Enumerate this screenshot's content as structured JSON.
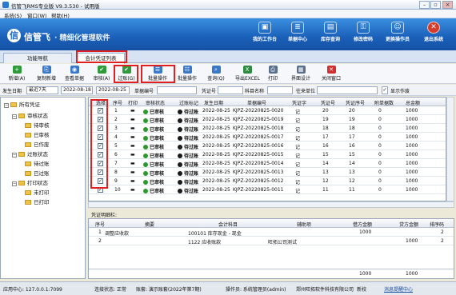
{
  "window": {
    "title": "信管飞RMS专业版 V9.3.530 - 试用版"
  },
  "menu": [
    "系统(S)",
    "窗口(W)",
    "帮助(H)"
  ],
  "brand": {
    "name": "信管飞",
    "tagline": "· 精细化管理软件",
    "icon": "信"
  },
  "banner_buttons": [
    {
      "label": "我的工作台",
      "icon": "desk-icon",
      "glyph": "▣"
    },
    {
      "label": "单据中心",
      "icon": "document-center-icon",
      "glyph": "≣"
    },
    {
      "label": "库存查询",
      "icon": "inventory-icon",
      "glyph": "▤"
    },
    {
      "label": "修改密码",
      "icon": "key-icon",
      "glyph": "⚿"
    },
    {
      "label": "更换操作员",
      "icon": "users-icon",
      "glyph": "☺"
    },
    {
      "label": "退出系统",
      "icon": "exit-icon",
      "glyph": "✕"
    }
  ],
  "tabs": [
    {
      "label": "功能导航"
    },
    {
      "label": "会计凭证列表"
    }
  ],
  "toolbar": [
    {
      "label": "新增(A)",
      "icon": "add-icon",
      "glyph": "+",
      "color": "#2f9a3a"
    },
    {
      "label": "复制新增",
      "icon": "copy-icon",
      "glyph": "⎘",
      "color": "#3a78c8"
    },
    {
      "label": "查看单据",
      "icon": "view-icon",
      "glyph": "◉",
      "color": "#3a78c8"
    },
    {
      "label": "审核(A)",
      "icon": "audit-icon",
      "glyph": "✔",
      "color": "#2f9a3a"
    },
    {
      "label": "过账(G)",
      "icon": "post-icon",
      "glyph": "✔",
      "color": "#2f9a3a"
    },
    {
      "label": "批量操作",
      "icon": "batch-icon",
      "glyph": "☰",
      "color": "#3a78c8"
    },
    {
      "label": "批量操作",
      "icon": "batch-ops-icon",
      "glyph": "☷",
      "color": "#3a78c8"
    },
    {
      "label": "查询(Q)",
      "icon": "query-icon",
      "glyph": "⌕",
      "color": "#3a78c8"
    },
    {
      "label": "导出EXCEL",
      "icon": "excel-icon",
      "glyph": "X",
      "color": "#2e8a3e"
    },
    {
      "label": "打印",
      "icon": "print-icon",
      "glyph": "⎙",
      "color": "#5a6f8c"
    },
    {
      "label": "界面设计",
      "icon": "design-icon",
      "glyph": "▦",
      "color": "#5a6f8c"
    },
    {
      "label": "关闭窗口",
      "icon": "close-window-icon",
      "glyph": "✕",
      "color": "#d03030"
    }
  ],
  "filter": {
    "date_label": "发生日期",
    "range": "最近7天",
    "date_from": "2022-08-18",
    "date_to": "2022-08-25",
    "order_label": "单据编号",
    "voucher_label": "凭证号",
    "subject_label": "科目名称",
    "partner_label": "往来单位",
    "show_void": "显示作废",
    "show_void_checked": true
  },
  "tree": {
    "root": "所有凭证",
    "groups": [
      {
        "label": "审核状态",
        "items": [
          "待审核",
          "已审核",
          "已作废"
        ]
      },
      {
        "label": "过账状态",
        "items": [
          "待过账",
          "已过账"
        ]
      },
      {
        "label": "打印状态",
        "items": [
          "未打印",
          "已打印"
        ]
      }
    ]
  },
  "grid": {
    "headers": [
      "选择",
      "序号",
      "打印",
      "审核状态",
      "过账标记",
      "发生日期",
      "单据编号",
      "凭证字",
      "凭证号",
      "凭证序号",
      "附单据数",
      "总金额"
    ],
    "rows": [
      {
        "no": "1",
        "audit": "已审核",
        "post": "待过账",
        "date": "2022-08-25",
        "code": "KJPZ-20220825-0020",
        "word": "记",
        "num": "20",
        "seq": "20",
        "att": "0",
        "amount": "1000"
      },
      {
        "no": "2",
        "audit": "已审核",
        "post": "待过账",
        "date": "2022-08-25",
        "code": "KJPZ-20220825-0019",
        "word": "记",
        "num": "19",
        "seq": "19",
        "att": "0",
        "amount": "1000"
      },
      {
        "no": "3",
        "audit": "已审核",
        "post": "待过账",
        "date": "2022-08-25",
        "code": "KJPZ-20220825-0018",
        "word": "记",
        "num": "18",
        "seq": "18",
        "att": "0",
        "amount": "1000"
      },
      {
        "no": "4",
        "audit": "已审核",
        "post": "待过账",
        "date": "2022-08-25",
        "code": "KJPZ-20220825-0017",
        "word": "记",
        "num": "17",
        "seq": "17",
        "att": "0",
        "amount": "1000"
      },
      {
        "no": "5",
        "audit": "已审核",
        "post": "待过账",
        "date": "2022-08-25",
        "code": "KJPZ-20220825-0016",
        "word": "记",
        "num": "16",
        "seq": "16",
        "att": "0",
        "amount": "1000"
      },
      {
        "no": "6",
        "audit": "已审核",
        "post": "待过账",
        "date": "2022-08-25",
        "code": "KJPZ-20220825-0015",
        "word": "记",
        "num": "15",
        "seq": "15",
        "att": "0",
        "amount": "1000"
      },
      {
        "no": "7",
        "audit": "已审核",
        "post": "待过账",
        "date": "2022-08-25",
        "code": "KJPZ-20220825-0014",
        "word": "记",
        "num": "14",
        "seq": "14",
        "att": "0",
        "amount": "1000"
      },
      {
        "no": "8",
        "audit": "已审核",
        "post": "待过账",
        "date": "2022-08-25",
        "code": "KJPZ-20220825-0013",
        "word": "记",
        "num": "13",
        "seq": "13",
        "att": "0",
        "amount": "1000"
      },
      {
        "no": "9",
        "audit": "已审核",
        "post": "待过账",
        "date": "2022-08-25",
        "code": "KJPZ-20220825-0012",
        "word": "记",
        "num": "12",
        "seq": "12",
        "att": "0",
        "amount": "1000"
      },
      {
        "no": "10",
        "audit": "已审核",
        "post": "待过账",
        "date": "2022-08-25",
        "code": "KJPZ-20220825-0011",
        "word": "记",
        "num": "11",
        "seq": "11",
        "att": "0",
        "amount": "1000"
      }
    ],
    "audit_color": "#2a9a2a",
    "post_color": "#1a1a1a"
  },
  "detail": {
    "title": "凭证明细栏:",
    "headers": [
      "序号",
      "摘要",
      "会计科目",
      "辅助项",
      "借方金额",
      "贷方金额",
      "排序码"
    ],
    "rows": [
      {
        "no": "1",
        "summary": "调整应收款",
        "subject": "100101 库存现金 - 现金",
        "aux": "",
        "debit": "1000",
        "credit": "",
        "sort": "2"
      },
      {
        "no": "2",
        "summary": "",
        "subject": "1122 应收账款",
        "aux": "旺拓公司测试",
        "debit": "",
        "credit": "1000",
        "sort": "2"
      }
    ],
    "total_debit": "1000",
    "total_credit": "1000"
  },
  "status": {
    "app_center": "应用中心: 127.0.0.1:7099",
    "conn": "连接状态: 正常",
    "book": "账套: 演示账套(2022年第7期)",
    "operator": "操作员: 系统管理员(admin)",
    "company": "郑州旺拓软件科技有限公司",
    "mode": "新校",
    "msg": "消息提醒中心"
  }
}
